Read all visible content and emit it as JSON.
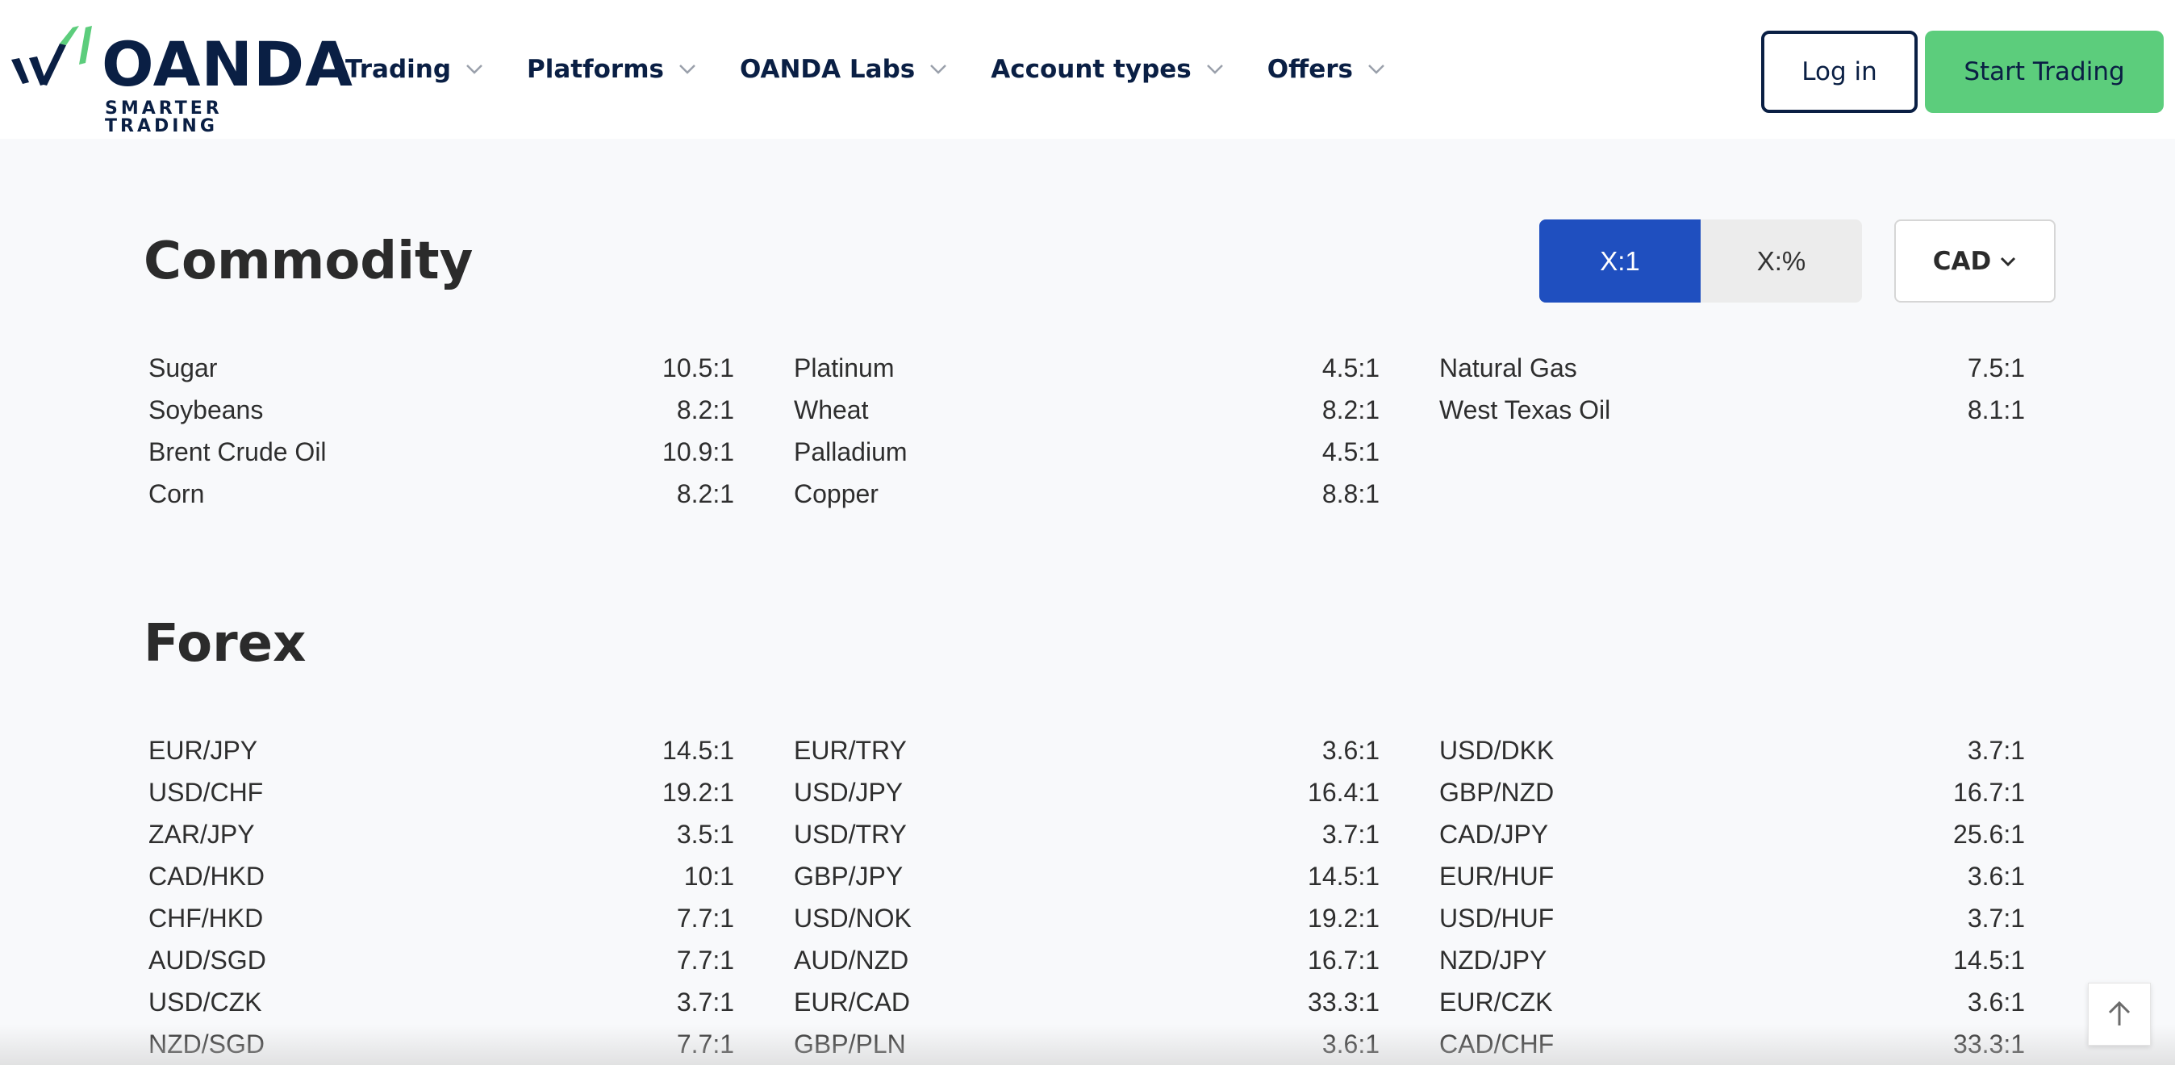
{
  "header": {
    "logo": {
      "word": "OANDA",
      "tagline": "SMARTER TRADING"
    },
    "nav": [
      {
        "label": "Trading"
      },
      {
        "label": "Platforms"
      },
      {
        "label": "OANDA Labs"
      },
      {
        "label": "Account types"
      },
      {
        "label": "Offers"
      }
    ],
    "login_label": "Log in",
    "start_label": "Start Trading"
  },
  "controls": {
    "toggle": [
      {
        "label": "X:1",
        "active": true
      },
      {
        "label": "X:%",
        "active": false
      }
    ],
    "currency": "CAD"
  },
  "colors": {
    "navy": "#0a1f44",
    "green": "#5ccd7c",
    "blue": "#1f4fbf"
  },
  "commodity": {
    "title": "Commodity",
    "columns": [
      [
        {
          "name": "Sugar",
          "value": "10.5:1"
        },
        {
          "name": "Soybeans",
          "value": "8.2:1"
        },
        {
          "name": "Brent Crude Oil",
          "value": "10.9:1"
        },
        {
          "name": "Corn",
          "value": "8.2:1"
        }
      ],
      [
        {
          "name": "Platinum",
          "value": "4.5:1"
        },
        {
          "name": "Wheat",
          "value": "8.2:1"
        },
        {
          "name": "Palladium",
          "value": "4.5:1"
        },
        {
          "name": "Copper",
          "value": "8.8:1"
        }
      ],
      [
        {
          "name": "Natural Gas",
          "value": "7.5:1"
        },
        {
          "name": "West Texas Oil",
          "value": "8.1:1"
        }
      ]
    ]
  },
  "forex": {
    "title": "Forex",
    "columns": [
      [
        {
          "name": "EUR/JPY",
          "value": "14.5:1"
        },
        {
          "name": "USD/CHF",
          "value": "19.2:1"
        },
        {
          "name": "ZAR/JPY",
          "value": "3.5:1"
        },
        {
          "name": "CAD/HKD",
          "value": "10:1"
        },
        {
          "name": "CHF/HKD",
          "value": "7.7:1"
        },
        {
          "name": "AUD/SGD",
          "value": "7.7:1"
        },
        {
          "name": "USD/CZK",
          "value": "3.7:1"
        },
        {
          "name": "NZD/SGD",
          "value": "7.7:1"
        }
      ],
      [
        {
          "name": "EUR/TRY",
          "value": "3.6:1"
        },
        {
          "name": "USD/JPY",
          "value": "16.4:1"
        },
        {
          "name": "USD/TRY",
          "value": "3.7:1"
        },
        {
          "name": "GBP/JPY",
          "value": "14.5:1"
        },
        {
          "name": "USD/NOK",
          "value": "19.2:1"
        },
        {
          "name": "AUD/NZD",
          "value": "16.7:1"
        },
        {
          "name": "EUR/CAD",
          "value": "33.3:1"
        },
        {
          "name": "GBP/PLN",
          "value": "3.6:1"
        }
      ],
      [
        {
          "name": "USD/DKK",
          "value": "3.7:1"
        },
        {
          "name": "GBP/NZD",
          "value": "16.7:1"
        },
        {
          "name": "CAD/JPY",
          "value": "25.6:1"
        },
        {
          "name": "EUR/HUF",
          "value": "3.6:1"
        },
        {
          "name": "USD/HUF",
          "value": "3.7:1"
        },
        {
          "name": "NZD/JPY",
          "value": "14.5:1"
        },
        {
          "name": "EUR/CZK",
          "value": "3.6:1"
        },
        {
          "name": "CAD/CHF",
          "value": "33.3:1"
        }
      ]
    ]
  }
}
